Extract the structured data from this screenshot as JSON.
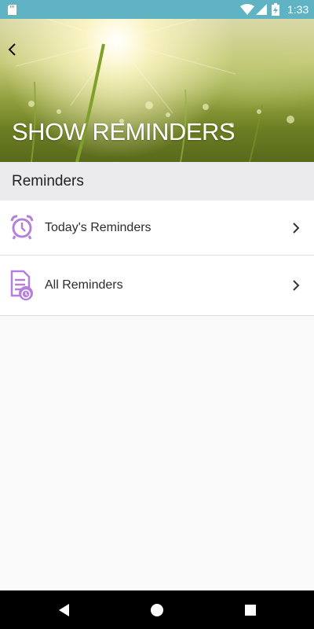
{
  "status_bar": {
    "time": "1:33",
    "background_color": "#5fb3c2",
    "icons": [
      "sd-card-icon",
      "wifi-icon",
      "signal-icon",
      "battery-charging-icon"
    ]
  },
  "header": {
    "title": "SHOW REMINDERS",
    "back_icon": "chevron-left-icon"
  },
  "section": {
    "label": "Reminders"
  },
  "items": [
    {
      "label": "Today's Reminders",
      "icon": "alarm-clock-icon",
      "accent_color": "#b57fdc"
    },
    {
      "label": "All Reminders",
      "icon": "document-clock-icon",
      "accent_color": "#b57fdc"
    }
  ],
  "nav_bar": {
    "buttons": [
      "back-triangle-icon",
      "home-circle-icon",
      "recents-square-icon"
    ]
  }
}
